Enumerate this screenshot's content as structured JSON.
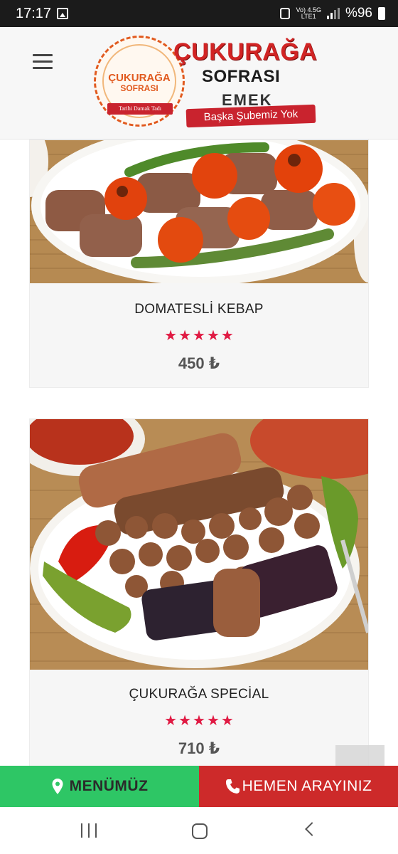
{
  "status_bar": {
    "time": "17:17",
    "network_top": "Vo) 4.5G",
    "network_bottom": "LTE1",
    "battery": "%96",
    "icons": [
      "gallery-icon",
      "alarm-icon",
      "signal-icon",
      "battery-icon"
    ]
  },
  "header": {
    "logo": {
      "badge_title": "ÇUKURAĞA",
      "badge_subtitle": "SOFRASI",
      "badge_tagline": "Tarihi Damak Tadı",
      "title": "ÇUKURAĞA",
      "subtitle": "SOFRASI",
      "branch": "EMEK",
      "banner": "Başka Şubemiz Yok"
    },
    "menu_icon": "hamburger-menu-icon"
  },
  "products": [
    {
      "name": "DOMATESLİ KEBAP",
      "rating": 5,
      "price": "450 ₺"
    },
    {
      "name": "ÇUKURAĞA SPECİAL",
      "rating": 5,
      "price": "710 ₺"
    }
  ],
  "action_bar": {
    "menu_label": "MENÜMÜZ",
    "call_label": "HEMEN ARAYINIZ",
    "menu_color": "#2ec665",
    "call_color": "#cd2a2a"
  },
  "scroll_top_icon": "chevron-up-icon",
  "nav_bar": {
    "icons": [
      "recents-icon",
      "home-icon",
      "back-icon"
    ]
  }
}
